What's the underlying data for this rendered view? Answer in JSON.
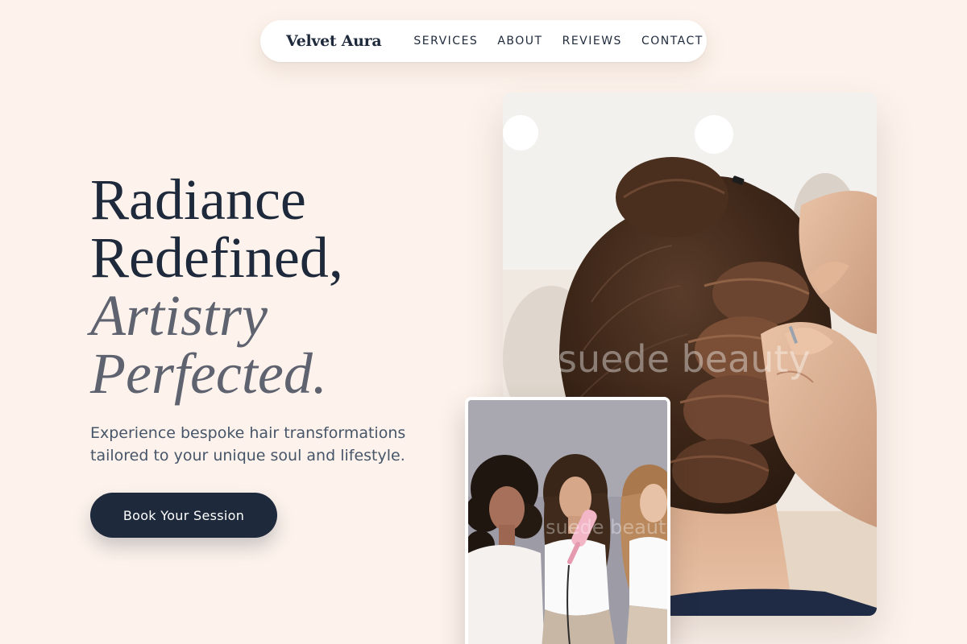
{
  "nav": {
    "brand": "Velvet Aura",
    "links": [
      "SERVICES",
      "ABOUT",
      "REVIEWS",
      "CONTACT"
    ]
  },
  "hero": {
    "title_lines": [
      "Radiance",
      "Redefined,"
    ],
    "accent_lines": [
      "Artistry",
      "Perfected."
    ],
    "subtitle": "Experience bespoke hair transformations tailored to your unique soul and lifestyle.",
    "cta_label": "Book Your Session"
  },
  "images": {
    "main_watermark": "suede beauty",
    "second_watermark": "suede beauty"
  },
  "colors": {
    "background": "#fdf3ec",
    "primary": "#1e293b",
    "accent_text": "#5f6370",
    "body_text": "#475569"
  }
}
